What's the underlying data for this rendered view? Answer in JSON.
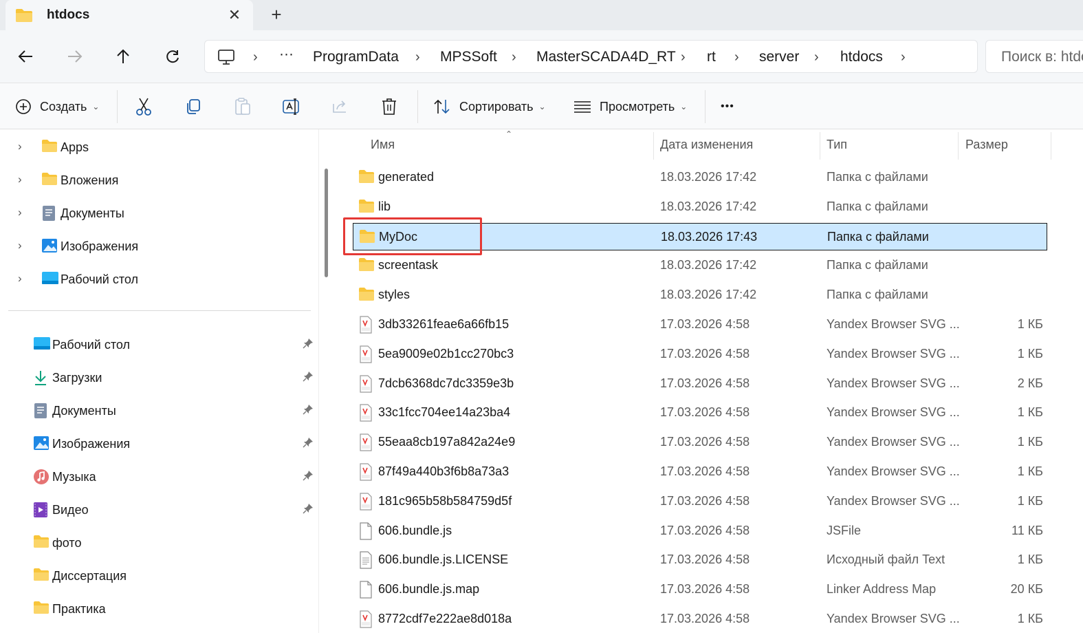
{
  "tab": {
    "title": "htdocs",
    "close": "✕",
    "new_tab": "+"
  },
  "nav_buttons": {
    "back": "back",
    "forward": "forward",
    "up": "up",
    "refresh": "refresh"
  },
  "breadcrumb": {
    "ellipsis": "···",
    "items": [
      "ProgramData",
      "MPSSoft",
      "MasterSCADA4D_RT",
      "rt",
      "server",
      "htdocs"
    ]
  },
  "search": {
    "placeholder": "Поиск в: htdocs"
  },
  "toolbar": {
    "create_label": "Создать",
    "sort_label": "Сортировать",
    "view_label": "Просмотреть",
    "more_label": "•••"
  },
  "nav_tree": [
    {
      "label": "Apps",
      "icon": "folder-icon"
    },
    {
      "label": "Вложения",
      "icon": "folder-icon"
    },
    {
      "label": "Документы",
      "icon": "documents-icon"
    },
    {
      "label": "Изображения",
      "icon": "pictures-icon"
    },
    {
      "label": "Рабочий стол",
      "icon": "desktop-icon"
    }
  ],
  "quick_access": [
    {
      "label": "Рабочий стол",
      "icon": "desktop-icon",
      "pinned": true
    },
    {
      "label": "Загрузки",
      "icon": "download-icon",
      "pinned": true
    },
    {
      "label": "Документы",
      "icon": "documents-icon",
      "pinned": true
    },
    {
      "label": "Изображения",
      "icon": "pictures-icon",
      "pinned": true
    },
    {
      "label": "Музыка",
      "icon": "music-icon",
      "pinned": true
    },
    {
      "label": "Видео",
      "icon": "video-icon",
      "pinned": true
    },
    {
      "label": "фото",
      "icon": "folder-icon",
      "pinned": false
    },
    {
      "label": "Диссертация",
      "icon": "folder-icon",
      "pinned": false
    },
    {
      "label": "Практика",
      "icon": "folder-icon",
      "pinned": false
    }
  ],
  "columns": {
    "name": "Имя",
    "date": "Дата изменения",
    "type": "Тип",
    "size": "Размер"
  },
  "files": [
    {
      "name": "generated",
      "date": "18.03.2026 17:42",
      "type": "Папка с файлами",
      "size": "",
      "icon": "folder-icon"
    },
    {
      "name": "lib",
      "date": "18.03.2026 17:42",
      "type": "Папка с файлами",
      "size": "",
      "icon": "folder-icon"
    },
    {
      "name": "MyDoc",
      "date": "18.03.2026 17:43",
      "type": "Папка с файлами",
      "size": "",
      "icon": "folder-icon",
      "selected": true
    },
    {
      "name": "screentask",
      "date": "18.03.2026 17:42",
      "type": "Папка с файлами",
      "size": "",
      "icon": "folder-icon"
    },
    {
      "name": "styles",
      "date": "18.03.2026 17:42",
      "type": "Папка с файлами",
      "size": "",
      "icon": "folder-icon"
    },
    {
      "name": "3db33261feae6a66fb15",
      "date": "17.03.2026 4:58",
      "type": "Yandex Browser SVG ...",
      "size": "1 КБ",
      "icon": "svg-file-icon"
    },
    {
      "name": "5ea9009e02b1cc270bc3",
      "date": "17.03.2026 4:58",
      "type": "Yandex Browser SVG ...",
      "size": "1 КБ",
      "icon": "svg-file-icon"
    },
    {
      "name": "7dcb6368dc7dc3359e3b",
      "date": "17.03.2026 4:58",
      "type": "Yandex Browser SVG ...",
      "size": "2 КБ",
      "icon": "svg-file-icon"
    },
    {
      "name": "33c1fcc704ee14a23ba4",
      "date": "17.03.2026 4:58",
      "type": "Yandex Browser SVG ...",
      "size": "1 КБ",
      "icon": "svg-file-icon"
    },
    {
      "name": "55eaa8cb197a842a24e9",
      "date": "17.03.2026 4:58",
      "type": "Yandex Browser SVG ...",
      "size": "1 КБ",
      "icon": "svg-file-icon"
    },
    {
      "name": "87f49a440b3f6b8a73a3",
      "date": "17.03.2026 4:58",
      "type": "Yandex Browser SVG ...",
      "size": "1 КБ",
      "icon": "svg-file-icon"
    },
    {
      "name": "181c965b58b584759d5f",
      "date": "17.03.2026 4:58",
      "type": "Yandex Browser SVG ...",
      "size": "1 КБ",
      "icon": "svg-file-icon"
    },
    {
      "name": "606.bundle.js",
      "date": "17.03.2026 4:58",
      "type": "JSFile",
      "size": "11 КБ",
      "icon": "blank-file-icon"
    },
    {
      "name": "606.bundle.js.LICENSE",
      "date": "17.03.2026 4:58",
      "type": "Исходный файл Text",
      "size": "1 КБ",
      "icon": "text-file-icon"
    },
    {
      "name": "606.bundle.js.map",
      "date": "17.03.2026 4:58",
      "type": "Linker Address Map",
      "size": "20 КБ",
      "icon": "blank-file-icon"
    },
    {
      "name": "8772cdf7e222ae8d018a",
      "date": "17.03.2026 4:58",
      "type": "Yandex Browser SVG ...",
      "size": "1 КБ",
      "icon": "svg-file-icon"
    }
  ],
  "colors": {
    "selection_bg": "#cce8ff",
    "highlight_border": "#e53935",
    "folder": "#f8c53a",
    "accent": "#0067c0"
  }
}
